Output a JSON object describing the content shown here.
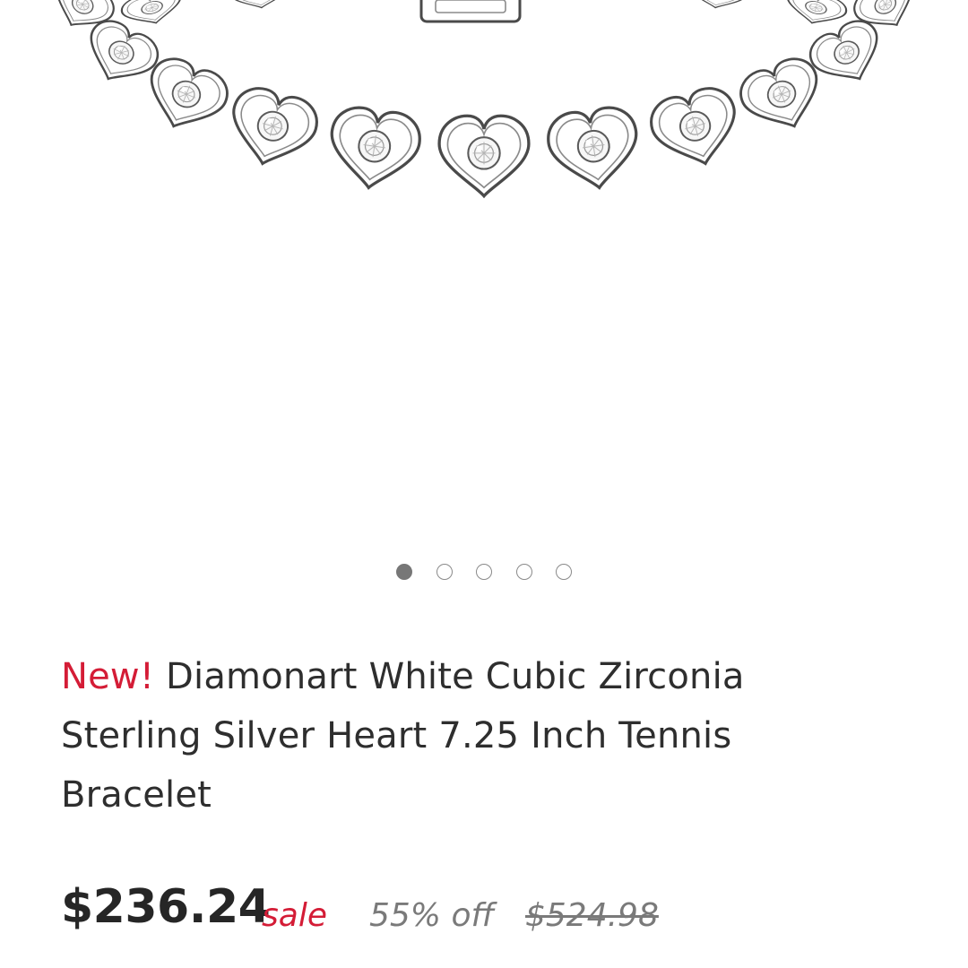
{
  "product": {
    "badge": "New!",
    "title": "Diamonart White Cubic Zirconia Sterling Silver Heart 7.25 Inch Tennis Bracelet",
    "image_icon": "heart-tennis-bracelet"
  },
  "gallery": {
    "slide_count": 5,
    "active_index": 0
  },
  "pricing": {
    "sale_price": "$236.24",
    "sale_label": "sale",
    "discount": "55% off",
    "original_price": "$524.98"
  },
  "colors": {
    "accent_red": "#d41c36",
    "text_dark": "#2e2e2e",
    "text_muted": "#7a7a7a",
    "dot_active": "#777777",
    "metal_stroke": "#4a4a4a"
  }
}
